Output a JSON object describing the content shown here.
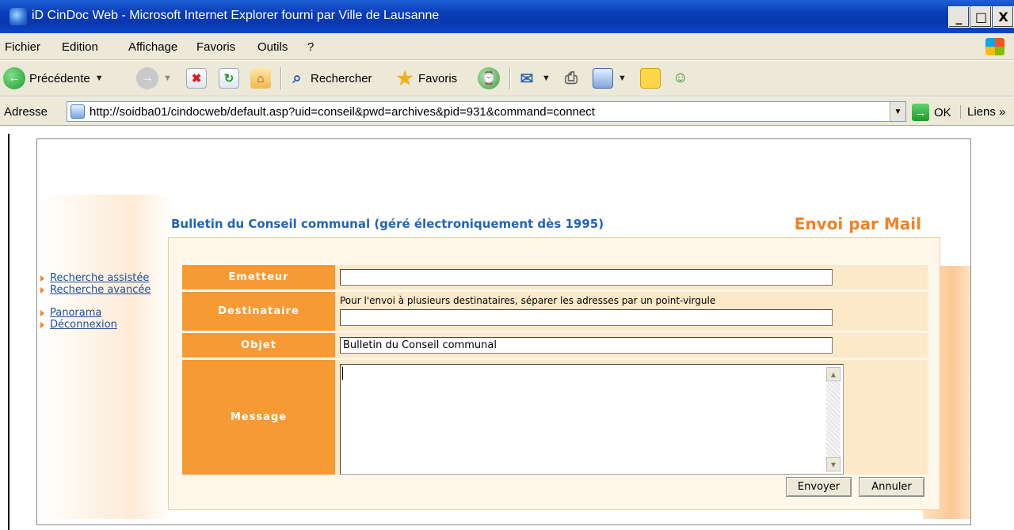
{
  "window": {
    "title": "iD CinDoc Web - Microsoft Internet Explorer fourni par Ville de Lausanne",
    "minimize": "_",
    "maximize": "□",
    "close": "X"
  },
  "menu": [
    "Fichier",
    "Edition",
    "Affichage",
    "Favoris",
    "Outils",
    "?"
  ],
  "toolbar": {
    "back": "Précédente",
    "search": "Rechercher",
    "favorites": "Favoris"
  },
  "address": {
    "label": "Adresse",
    "url": "http://soidba01/cindocweb/default.asp?uid=conseil&pwd=archives&pid=931&command=connect",
    "go": "OK",
    "links": "Liens",
    "more": "»"
  },
  "page": {
    "section_title": "Bulletin du Conseil communal (géré électroniquement dès 1995)",
    "heading": "Envoi par Mail"
  },
  "sidenav": [
    "Recherche assistée",
    "Recherche avancée",
    "Panorama",
    "Déconnexion"
  ],
  "form": {
    "sender_label": "Emetteur",
    "sender_value": "",
    "recipient_label": "Destinataire",
    "recipient_hint": "Pour l'envoi à plusieurs destinataires, séparer les adresses par un point-virgule",
    "recipient_value": "",
    "subject_label": "Objet",
    "subject_value": "Bulletin du Conseil communal",
    "message_label": "Message",
    "message_value": "",
    "send_label": "Envoyer",
    "cancel_label": "Annuler"
  }
}
